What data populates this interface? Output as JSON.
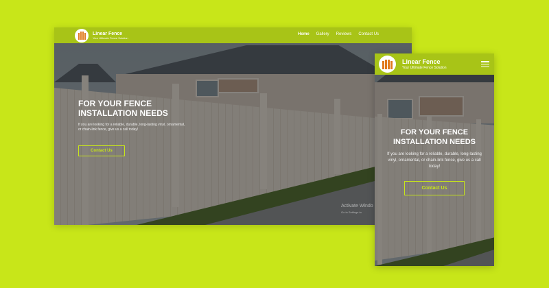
{
  "desktop": {
    "brand": {
      "name": "Linear Fence",
      "tagline": "Your Ultimate Fence Solution"
    },
    "nav": [
      {
        "label": "Home",
        "active": true
      },
      {
        "label": "Gallery",
        "active": false
      },
      {
        "label": "Reviews",
        "active": false
      },
      {
        "label": "Contact Us",
        "active": false
      }
    ],
    "hero": {
      "heading_line1": "FOR YOUR FENCE",
      "heading_line2": "INSTALLATION NEEDS",
      "body": "If you are looking for a reliable, durable, long-lasting vinyl, ornamental, or chain-link fence, give us a call today!",
      "cta_label": "Contact Us"
    },
    "watermark": {
      "line1": "Activate Windo",
      "line2": "Go to Settings to"
    }
  },
  "mobile": {
    "brand": {
      "name": "Linear Fence",
      "tagline": "Your Ultimate Fence Solution"
    },
    "menu_icon": "hamburger-icon",
    "hero": {
      "heading_line1": "FOR YOUR FENCE",
      "heading_line2": "INSTALLATION NEEDS",
      "body": "If you are looking for a reliable, durable, long-lasting vinyl, ornamental, or chain-link fence, give us a call today!",
      "cta_label": "Contact Us"
    }
  },
  "colors": {
    "background": "#c8e619",
    "header": "#a8c417",
    "accent": "#c8e619",
    "logo_picket": "#e07a1c"
  }
}
